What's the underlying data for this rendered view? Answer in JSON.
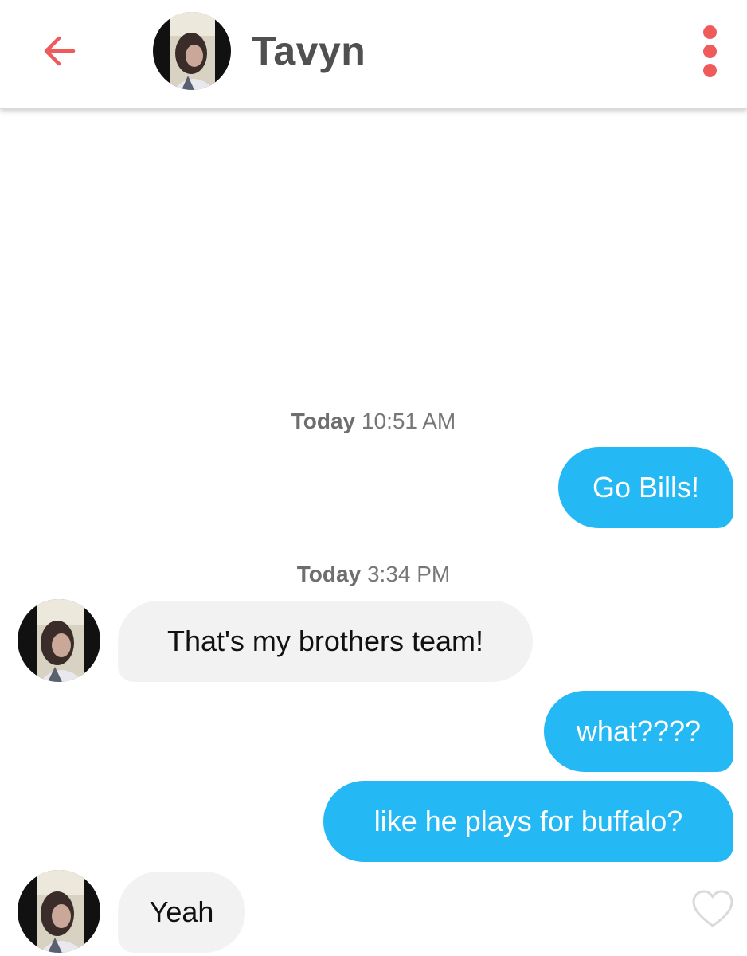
{
  "header": {
    "back_icon": "arrow-left-icon",
    "contact_name": "Tavyn",
    "menu_icon": "vertical-dots-icon",
    "accent_color": "#ef5b5b"
  },
  "conversation": {
    "timestamps": [
      {
        "day": "Today",
        "time": "10:51 AM"
      },
      {
        "day": "Today",
        "time": "3:34 PM"
      }
    ],
    "messages": [
      {
        "direction": "sent",
        "text": "Go Bills!"
      },
      {
        "direction": "received",
        "text": "That's my brothers team!"
      },
      {
        "direction": "sent",
        "text": "what????"
      },
      {
        "direction": "sent",
        "text": "like he plays for buffalo?"
      },
      {
        "direction": "received",
        "text": "Yeah"
      }
    ],
    "like_icon": "heart-outline-icon"
  },
  "colors": {
    "sent_bubble": "#24b8f4",
    "received_bubble": "#f2f2f2"
  }
}
